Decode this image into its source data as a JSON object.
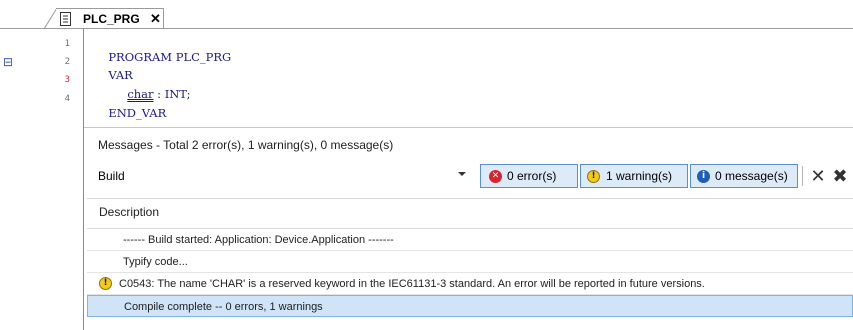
{
  "tab": {
    "label": "PLC_PRG",
    "close_label": "x"
  },
  "editor": {
    "lines": [
      {
        "number": "1",
        "text": "PROGRAM PLC_PRG"
      },
      {
        "number": "2",
        "text": "VAR"
      },
      {
        "number": "3",
        "ident": "char",
        "rest": " : INT;"
      },
      {
        "number": "4",
        "text": "END_VAR"
      }
    ],
    "collapse_glyph": "⊟"
  },
  "messages": {
    "title": "Messages - Total 2 error(s), 1 warning(s), 0 message(s)",
    "category": "Build",
    "filters": {
      "errors": "0 error(s)",
      "warnings": "1 warning(s)",
      "messages": "0 message(s)"
    },
    "column_header": "Description",
    "rows": [
      {
        "text": "------ Build started: Application: Device.Application -------",
        "icon": ""
      },
      {
        "text": "Typify code...",
        "icon": ""
      },
      {
        "text": "C0543:  The name 'CHAR' is a reserved keyword in the IEC61131-3 standard. An error will be reported in future versions.",
        "icon": "warning-icon"
      },
      {
        "text": "Compile complete -- 0 errors, 1 warnings",
        "icon": ""
      }
    ]
  },
  "colors": {
    "code_blue": "#1a1a8c",
    "error_red": "#d9232e",
    "warning_yellow": "#f3c91a",
    "info_blue": "#1d5fb8",
    "selection": "#cfe4f7"
  }
}
